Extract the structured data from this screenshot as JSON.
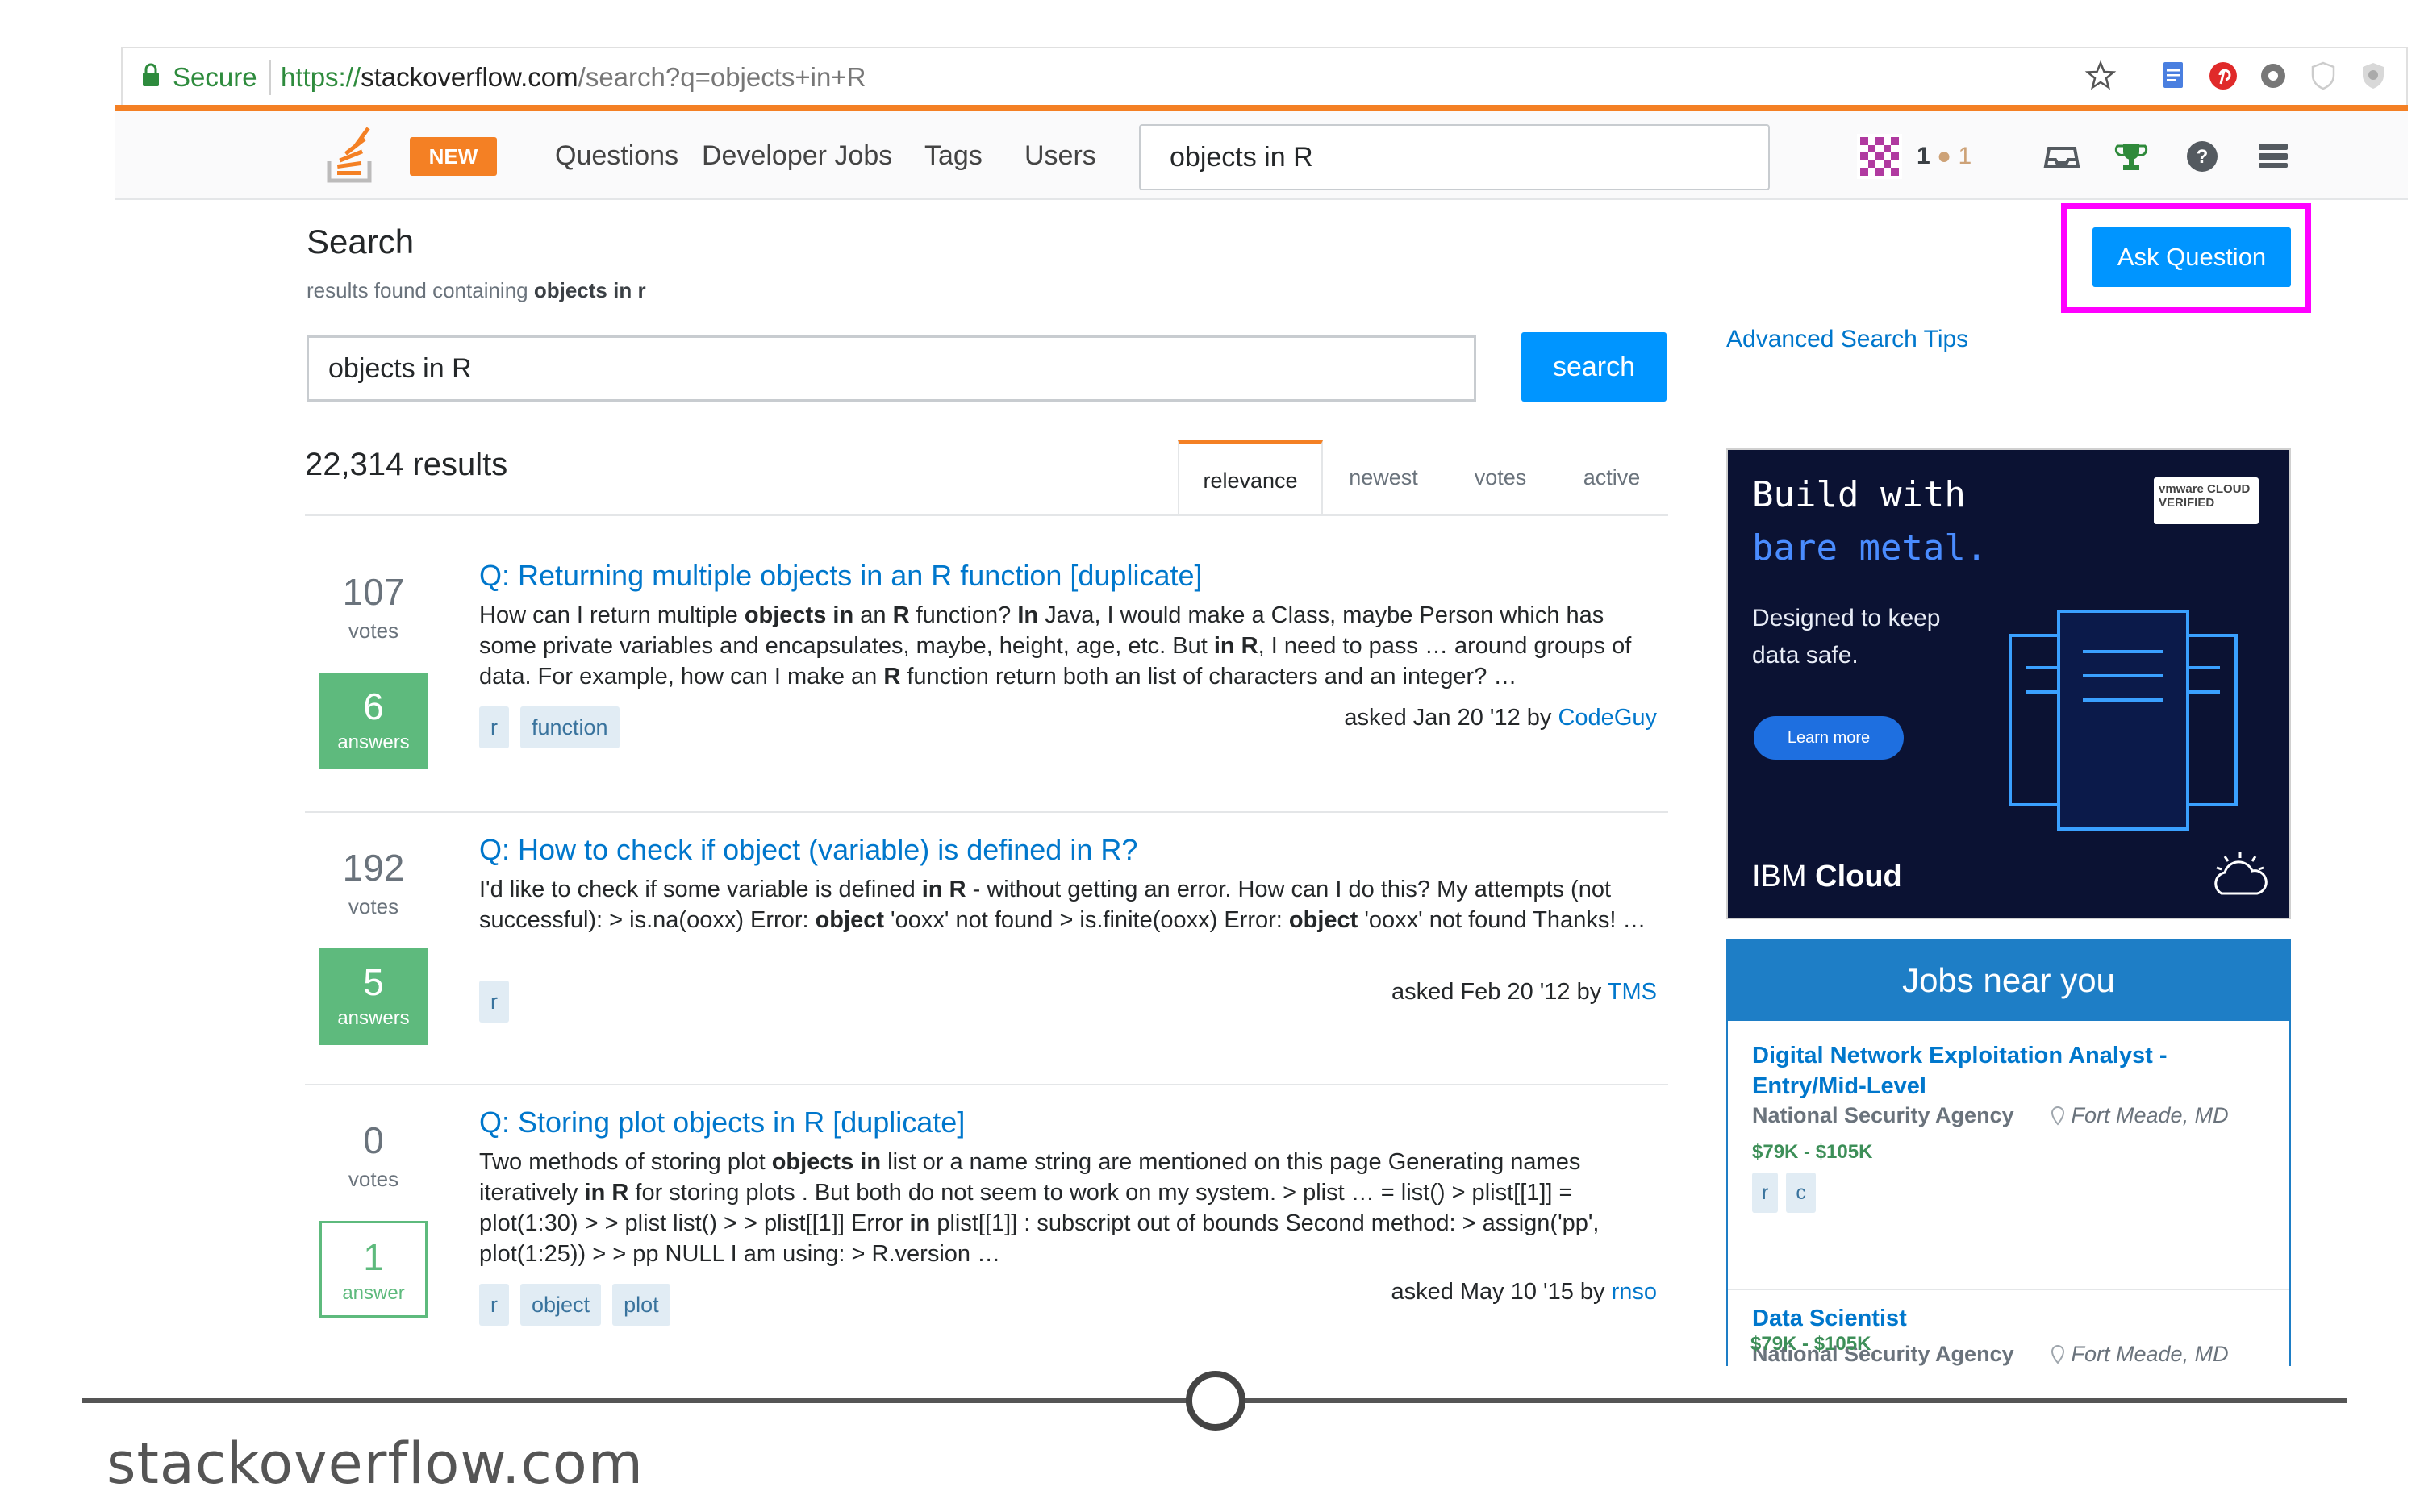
{
  "browser": {
    "secure_label": "Secure",
    "url_scheme": "https://",
    "url_host": "stackoverflow.com",
    "url_path": "/search?q=objects+in+R"
  },
  "header": {
    "new_badge": "NEW",
    "nav": [
      "Questions",
      "Developer Jobs",
      "Tags",
      "Users"
    ],
    "search_value": "objects in R",
    "reputation": "1",
    "bronze_badges": "1",
    "accent_color": "#f48024"
  },
  "main": {
    "title": "Search",
    "subtitle_prefix": "results found containing",
    "subtitle_query": "objects in r",
    "search_value": "objects in R",
    "search_button": "search",
    "ask_button": "Ask Question",
    "advanced_tips": "Advanced Search Tips",
    "results_count": "22,314 results",
    "tabs": [
      "relevance",
      "newest",
      "votes",
      "active"
    ],
    "active_tab": "relevance"
  },
  "results": [
    {
      "votes": "107",
      "votes_label": "votes",
      "answers": "6",
      "answers_label": "answers",
      "accepted": true,
      "title": "Q: Returning multiple objects in an R function [duplicate]",
      "excerpt_html": "How can I return multiple <b>objects</b> <b>in</b> an <b>R</b> function? <b>In</b> Java, I would make a Class, maybe Person which has some private variables and encapsulates, maybe, height, age, etc. But <b>in</b> <b>R</b>, I need to pass … around groups of data. For example, how can I make an <b>R</b> function return both an list of characters and an integer? …",
      "tags": [
        "r",
        "function"
      ],
      "asked": "asked Jan 20 '12 by",
      "user": "CodeGuy"
    },
    {
      "votes": "192",
      "votes_label": "votes",
      "answers": "5",
      "answers_label": "answers",
      "accepted": true,
      "title": "Q: How to check if object (variable) is defined in R?",
      "excerpt_html": "I'd like to check if some variable is defined <b>in</b> <b>R</b> - without getting an error. How can I do this? My attempts (not successful): &gt; is.na(ooxx) Error: <b>object</b> 'ooxx' not found &gt; is.finite(ooxx) Error: <b>object</b> 'ooxx' not found Thanks! …",
      "tags": [
        "r"
      ],
      "asked": "asked Feb 20 '12 by",
      "user": "TMS"
    },
    {
      "votes": "0",
      "votes_label": "votes",
      "answers": "1",
      "answers_label": "answer",
      "accepted": false,
      "title": "Q: Storing plot objects in R [duplicate]",
      "excerpt_html": "Two methods of storing plot <b>objects</b> <b>in</b> list or a name string are mentioned on this page Generating names iteratively <b>in</b> <b>R</b> for storing plots . But both do not seem to work on my system. &gt; plist … = list() &gt; plist[[1]] = plot(1:30) &gt; &gt; plist list() &gt; &gt; plist[[1]] Error <b>in</b> plist[[1]] : subscript out of bounds Second method: &gt; assign('pp', plot(1:25)) &gt; &gt; pp NULL I am using: &gt; R.version …",
      "tags": [
        "r",
        "object",
        "plot"
      ],
      "asked": "asked May 10 '15 by",
      "user": "rnso"
    }
  ],
  "ad": {
    "line1": "Build with",
    "line2": "bare metal.",
    "body": "Designed to keep data safe.",
    "cta": "Learn more",
    "brand_light": "IBM ",
    "brand_bold": "Cloud",
    "badge": "vmware CLOUD VERIFIED"
  },
  "jobs": {
    "header": "Jobs near you",
    "items": [
      {
        "title": "Digital Network Exploitation Analyst - Entry/Mid-Level",
        "company": "National Security Agency",
        "location": "Fort Meade, MD",
        "salary": "$79K - $105K",
        "tags": [
          "r",
          "c"
        ]
      },
      {
        "title": "Data Scientist",
        "company": "National Security Agency",
        "location": "Fort Meade, MD",
        "salary": "$79K - $105K",
        "tags": []
      }
    ]
  },
  "slide": {
    "caption": "stackoverflow.com"
  }
}
